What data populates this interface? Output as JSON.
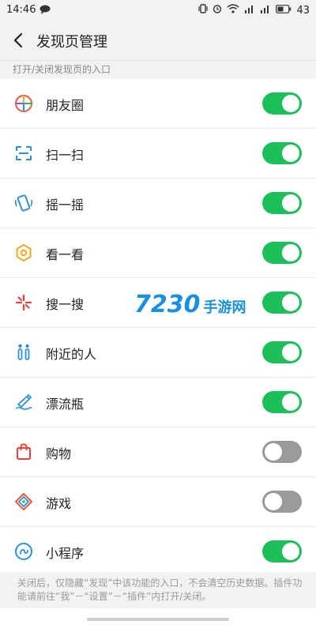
{
  "status": {
    "time": "14:46",
    "battery": "43"
  },
  "header": {
    "title": "发现页管理"
  },
  "section": {
    "label": "打开/关闭发现页的入口"
  },
  "items": [
    {
      "label": "朋友圈",
      "icon": "moments-icon",
      "enabled": true
    },
    {
      "label": "扫一扫",
      "icon": "scan-icon",
      "enabled": true
    },
    {
      "label": "摇一摇",
      "icon": "shake-icon",
      "enabled": true
    },
    {
      "label": "看一看",
      "icon": "top-stories-icon",
      "enabled": true
    },
    {
      "label": "搜一搜",
      "icon": "search-icon",
      "enabled": true
    },
    {
      "label": "附近的人",
      "icon": "people-nearby-icon",
      "enabled": true
    },
    {
      "label": "漂流瓶",
      "icon": "drift-bottle-icon",
      "enabled": true
    },
    {
      "label": "购物",
      "icon": "shopping-bag-icon",
      "enabled": false
    },
    {
      "label": "游戏",
      "icon": "games-icon",
      "enabled": false
    },
    {
      "label": "小程序",
      "icon": "mini-program-icon",
      "enabled": true
    }
  ],
  "footer": {
    "text": "关闭后，仅隐藏“发现”中该功能的入口，不会清空历史数据。插件功能请前往“我”－“设置”－“插件”内打开/关闭。"
  },
  "watermark": {
    "number": "7230",
    "text": "手游网"
  },
  "colors": {
    "toggle_on": "#1dbf5a",
    "toggle_off": "#9a9a9a",
    "header_bg": "#f2f2f2"
  }
}
